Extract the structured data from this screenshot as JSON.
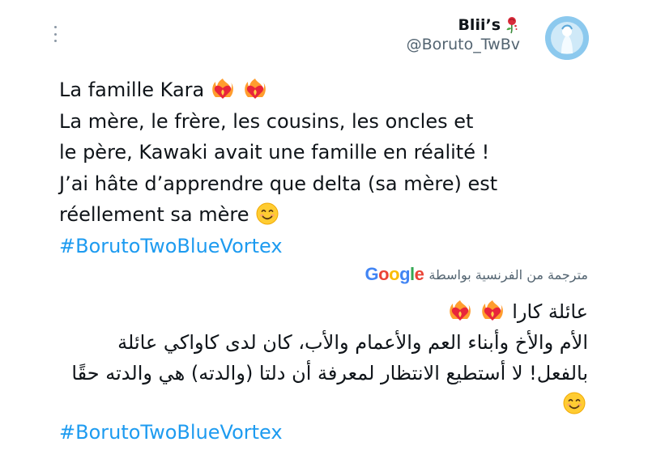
{
  "author": {
    "display_name": "Blii’s",
    "handle": "@Boruto_TwBv"
  },
  "tweet": {
    "line1": "La famille Kara",
    "line2": "La mère, le frère, les cousins, les oncles et",
    "line3": "le père, Kawaki avait une famille en réalité !",
    "line4": "J’ai hâte d’apprendre que delta (sa mère) est",
    "line5": "réellement sa mère",
    "hashtag": "#BorutoTwoBlueVortex"
  },
  "translation": {
    "label": "مترجمة من الفرنسية بواسطة",
    "provider": "Google",
    "line1": "عائلة كارا",
    "line2": "الأم والأخ وأبناء العم والأعمام والأب، كان لدى كاواكي عائلة",
    "line3": "بالفعل! لا أستطيع الانتظار لمعرفة أن دلتا (والدته) هي والدته حقًا",
    "hashtag": "#BorutoTwoBlueVortex"
  },
  "colors": {
    "hashtag": "#1d9bf0",
    "secondary_text": "#536471",
    "google_blue": "#4285F4",
    "google_red": "#EA4335",
    "google_yellow": "#FBBC05",
    "google_green": "#34A853"
  },
  "icons": [
    "more-options-icon",
    "rose-icon",
    "heart-on-fire-emoji",
    "smiling-face-emoji"
  ]
}
